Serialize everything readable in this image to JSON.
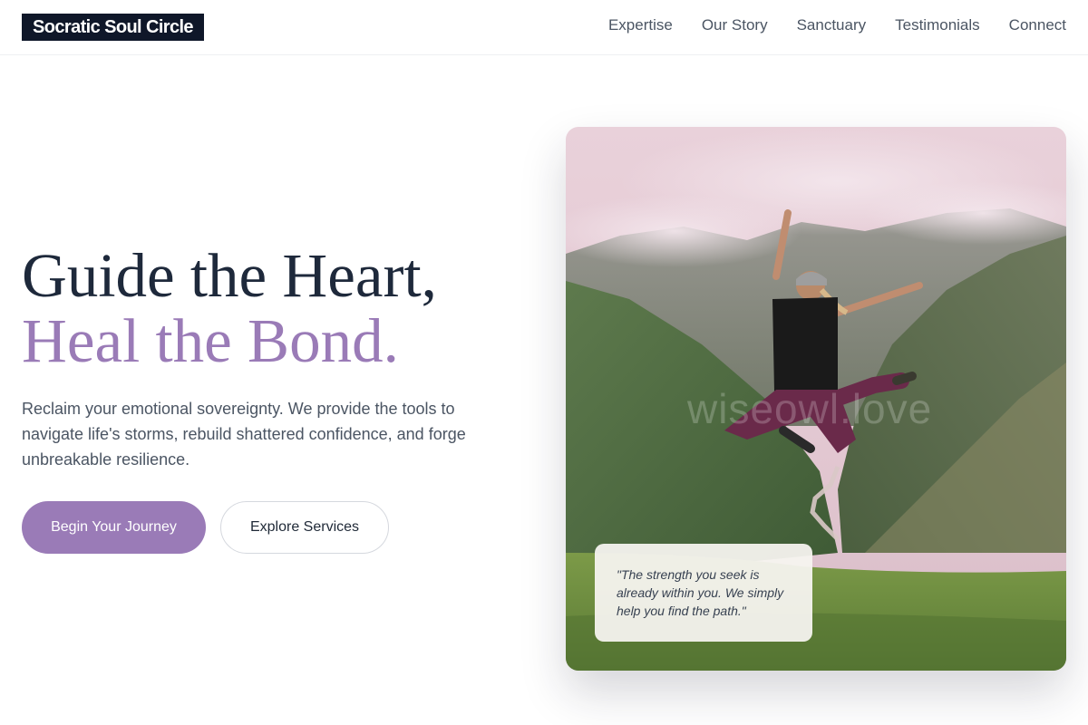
{
  "brand": {
    "name": "Socratic Soul Circle"
  },
  "nav": {
    "items": [
      {
        "label": "Expertise"
      },
      {
        "label": "Our Story"
      },
      {
        "label": "Sanctuary"
      },
      {
        "label": "Testimonials"
      },
      {
        "label": "Connect"
      }
    ]
  },
  "hero": {
    "headline_line1": "Guide the Heart,",
    "headline_line2": "Heal the Bond.",
    "lede": "Reclaim your emotional sovereignty. We provide the tools to navigate life's storms, rebuild shattered confidence, and forge unbreakable resilience.",
    "primary_cta": "Begin Your Journey",
    "secondary_cta": "Explore Services",
    "image_watermark": "wiseowl.love",
    "quote": "\"The strength you seek is already within you. We simply help you find the path.\""
  },
  "colors": {
    "brand_dark": "#0f1729",
    "accent_purple": "#9a7bb7",
    "heading_dark": "#1e293b",
    "body_gray": "#4b5563"
  }
}
